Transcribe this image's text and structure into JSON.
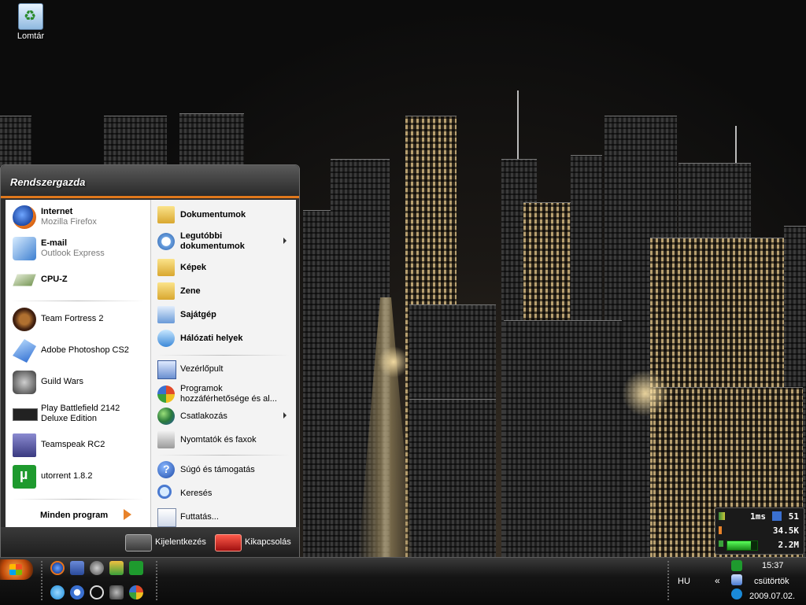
{
  "desktop": {
    "icon_label": "Lomtár"
  },
  "start_menu": {
    "user_name": "Rendszergazda",
    "pinned": [
      {
        "title": "Internet",
        "subtitle": "Mozilla Firefox",
        "icon": "firefox-icon"
      },
      {
        "title": "E-mail",
        "subtitle": "Outlook Express",
        "icon": "mail-icon"
      },
      {
        "title": "CPU-Z",
        "icon": "cpuz-icon"
      }
    ],
    "recent": [
      {
        "label": "Team Fortress 2",
        "icon": "team-fortress-icon"
      },
      {
        "label": "Adobe Photoshop CS2",
        "icon": "photoshop-icon"
      },
      {
        "label": "Guild Wars",
        "icon": "guild-wars-icon"
      },
      {
        "label": "Play Battlefield 2142",
        "label2": "Deluxe Edition",
        "icon": "battlefield-icon"
      },
      {
        "label": "Teamspeak RC2",
        "icon": "teamspeak-icon"
      },
      {
        "label": "utorrent 1.8.2",
        "icon": "utorrent-icon"
      }
    ],
    "all_programs": "Minden program",
    "right": {
      "documents": "Dokumentumok",
      "recent_docs": "Legutóbbi dokumentumok",
      "recent_docs_1": "Legutóbbi",
      "recent_docs_2": "dokumentumok",
      "pictures": "Képek",
      "music": "Zene",
      "my_computer": "Sajátgép",
      "network": "Hálózati helyek",
      "control_panel": "Vezérlőpult",
      "program_access_1": "Programok",
      "program_access_2": "hozzáférhetősége és al...",
      "connect": "Csatlakozás",
      "printers": "Nyomtatók és faxok",
      "help": "Súgó és támogatás",
      "search": "Keresés",
      "run": "Futtatás..."
    },
    "logoff": "Kijelentkezés",
    "shutdown": "Kikapcsolás"
  },
  "netmon": {
    "ping": "1ms",
    "count": "51",
    "up": "34.5K",
    "down": "2.2M",
    "down_fill": 0.8
  },
  "taskbar": {
    "language": "HU",
    "expand": "«",
    "time": "15:37",
    "day": "csütörtök",
    "date": "2009.07.02."
  },
  "colors": {
    "accent": "#e0781c",
    "taskbar": "#151515"
  }
}
